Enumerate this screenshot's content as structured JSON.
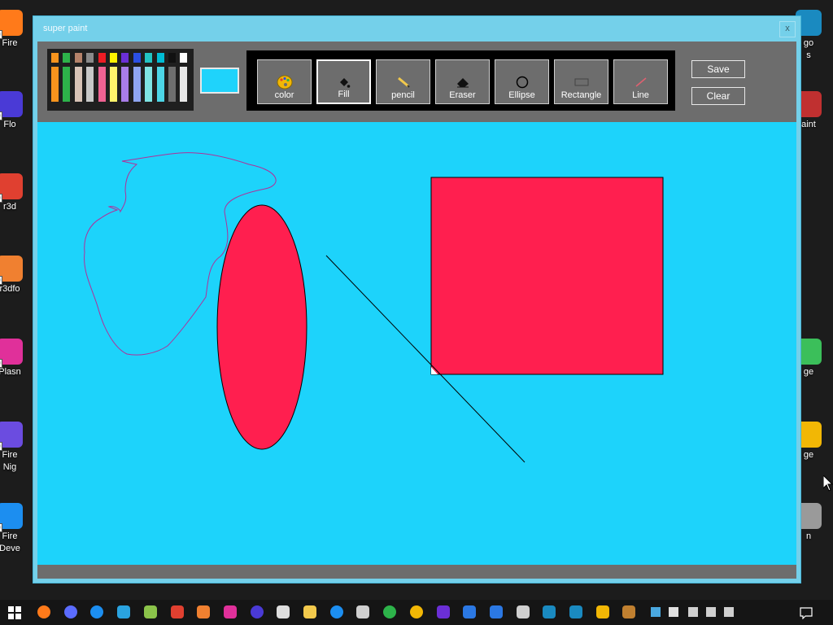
{
  "desktop": {
    "left_icons": [
      {
        "label": "Fire",
        "color": "#ff7a1a"
      },
      {
        "label": "Flo",
        "color": "#4a3ad6"
      },
      {
        "label": "r3d",
        "color": "#e04030"
      },
      {
        "label": "r3dfo",
        "color": "#f08030"
      },
      {
        "label": "Plasn",
        "color": "#e0309a"
      },
      {
        "label": "Fire\nNig",
        "color": "#6b4ce0"
      },
      {
        "label": "Fire\nDeve",
        "color": "#1c8ef0"
      }
    ],
    "right_icons": [
      {
        "label": "go\ns",
        "color": "#1a8ac0"
      },
      {
        "label": "aint",
        "color": "#c03030"
      },
      {
        "label": "ge",
        "color": "#3bbf5a"
      },
      {
        "label": "ge",
        "color": "#f2b705"
      },
      {
        "label": "n",
        "color": "#9a9a9a"
      }
    ]
  },
  "window": {
    "title": "super paint",
    "close_label": "x"
  },
  "palette": {
    "top_colors": [
      "#f7941d",
      "#2db34a",
      "#b5826a",
      "#8a8a8a",
      "#ed1c24",
      "#fff200",
      "#6b2fd6",
      "#2b4fe3",
      "#22c4c4",
      "#00bcd4",
      "#111111",
      "#ffffff"
    ],
    "bottom_colors": [
      "#f7941d",
      "#2db34a",
      "#d8c3b7",
      "#c8c8c8",
      "#f06292",
      "#fff36b",
      "#a87de8",
      "#8ea5f2",
      "#7ee4e4",
      "#4cd5e6",
      "#6e6e6e",
      "#e8e8e8"
    ],
    "selected": "#1fd3fb"
  },
  "tools": [
    {
      "label": "color",
      "icon": "palette-icon",
      "active": false
    },
    {
      "label": "Fill",
      "icon": "paint-bucket-icon",
      "active": true
    },
    {
      "label": "pencil",
      "icon": "pencil-icon",
      "active": false
    },
    {
      "label": "Eraser",
      "icon": "eraser-icon",
      "active": false
    },
    {
      "label": "Ellipse",
      "icon": "ellipse-icon",
      "active": false
    },
    {
      "label": "Rectangle",
      "icon": "rectangle-icon",
      "active": false
    },
    {
      "label": "Line",
      "icon": "line-icon",
      "active": false
    }
  ],
  "actions": {
    "save_label": "Save",
    "clear_label": "Clear"
  },
  "canvas": {
    "background": "#1dd3fb",
    "shape_fill": "#ff1f4f",
    "freehand_color": "#b0309a"
  },
  "taskbar": {
    "apps": [
      {
        "name": "firefox-icon",
        "color": "#ff7a1a"
      },
      {
        "name": "firefox-icon",
        "color": "#5b6cff"
      },
      {
        "name": "firefox-icon",
        "color": "#1c8ef0"
      },
      {
        "name": "app-icon",
        "color": "#2aa3e0"
      },
      {
        "name": "app-icon",
        "color": "#8bc34a"
      },
      {
        "name": "app-icon",
        "color": "#e04030"
      },
      {
        "name": "app-icon",
        "color": "#f08030"
      },
      {
        "name": "app-icon",
        "color": "#e0309a"
      },
      {
        "name": "floorp-icon",
        "color": "#4a3ad6"
      },
      {
        "name": "zen-icon",
        "color": "#dddddd"
      },
      {
        "name": "mercury-icon",
        "color": "#f2c94c"
      },
      {
        "name": "app-icon",
        "color": "#1c8ef0"
      },
      {
        "name": "app-icon",
        "color": "#cfcfcf"
      },
      {
        "name": "app-icon",
        "color": "#2db34a"
      },
      {
        "name": "chrome-icon",
        "color": "#f2b705"
      },
      {
        "name": "app-icon",
        "color": "#6b2fd6"
      },
      {
        "name": "app-icon",
        "color": "#2b78e3"
      },
      {
        "name": "app-icon",
        "color": "#2b78e3"
      },
      {
        "name": "app-icon",
        "color": "#cfcfcf"
      },
      {
        "name": "app-icon",
        "color": "#1a8ac0"
      },
      {
        "name": "app-icon",
        "color": "#1a8ac0"
      },
      {
        "name": "app-icon",
        "color": "#f2b705"
      },
      {
        "name": "app-icon",
        "color": "#c08030"
      }
    ]
  }
}
